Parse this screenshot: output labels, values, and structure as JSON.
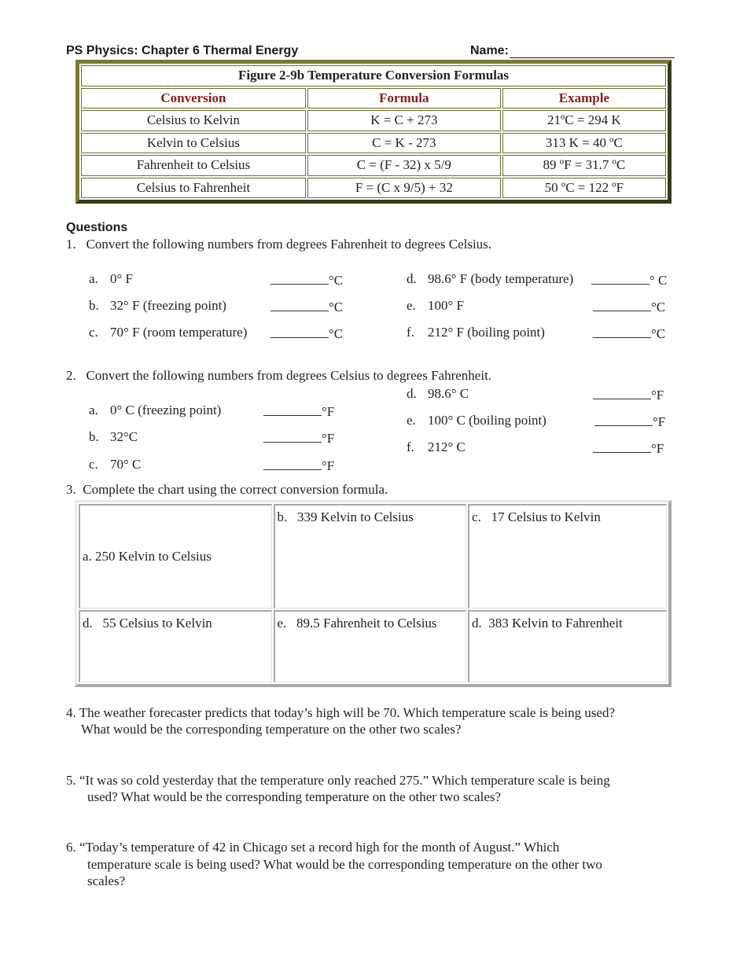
{
  "header": {
    "title": "PS Physics:  Chapter 6 Thermal Energy",
    "name_label": "Name:"
  },
  "formula_table": {
    "title": "Figure 2-9b Temperature Conversion Formulas",
    "columns": [
      "Conversion",
      "Formula",
      "Example"
    ],
    "rows": [
      {
        "conversion": "Celsius to Kelvin",
        "formula": "K = C + 273",
        "example": "21ºC = 294 K"
      },
      {
        "conversion": "Kelvin to Celsius",
        "formula": "C = K - 273",
        "example": "313 K = 40 ºC"
      },
      {
        "conversion": "Fahrenheit to Celsius",
        "formula": "C = (F - 32) x 5/9",
        "example": "89 ºF = 31.7 ºC"
      },
      {
        "conversion": "Celsius to Fahrenheit",
        "formula": "F = (C x 9/5) + 32",
        "example": "50 ºC = 122 ºF"
      }
    ],
    "colors": {
      "border_light": "#7a7a30",
      "border_dark": "#3a3a1a",
      "header_text": "#8b1a1a"
    }
  },
  "questions_heading": "Questions",
  "q1": {
    "text": "1.   Convert the following numbers from degrees Fahrenheit to degrees Celsius.",
    "items": [
      {
        "letter": "a.",
        "label": "0° F",
        "unit": "°C"
      },
      {
        "letter": "b.",
        "label": "32° F (freezing point)",
        "unit": "°C"
      },
      {
        "letter": "c.",
        "label": "70° F (room temperature)",
        "unit": "°C"
      },
      {
        "letter": "d.",
        "label": "98.6° F (body temperature)",
        "unit": "° C"
      },
      {
        "letter": "e.",
        "label": "100° F",
        "unit": "°C"
      },
      {
        "letter": "f.",
        "label": "212° F (boiling point)",
        "unit": "°C"
      }
    ]
  },
  "q2": {
    "text": "2.   Convert the following numbers from degrees Celsius to degrees Fahrenheit.",
    "items": [
      {
        "letter": "a.",
        "label": "0° C (freezing point)",
        "unit": "°F"
      },
      {
        "letter": "b.",
        "label": "32°C",
        "unit": "°F"
      },
      {
        "letter": "c.",
        "label": "70° C",
        "unit": "°F"
      },
      {
        "letter": "d.",
        "label": "98.6° C",
        "unit": "°F"
      },
      {
        "letter": "e.",
        "label": "100° C (boiling point)",
        "unit": "°F"
      },
      {
        "letter": "f.",
        "label": "212° C",
        "unit": "°F"
      }
    ]
  },
  "q3": {
    "text": "3.  Complete the chart using the correct conversion formula.",
    "cells": [
      "a. 250 Kelvin to Celsius",
      "b.   339 Kelvin to Celsius",
      "c.   17 Celsius to Kelvin",
      "d.   55 Celsius to Kelvin",
      "e.   89.5 Fahrenheit to Celsius",
      "d.  383 Kelvin to Fahrenheit"
    ]
  },
  "q4": {
    "line1": "4. The weather forecaster predicts that today’s high will be 70. Which temperature scale is being used?",
    "line2": "What would be the corresponding temperature on the other two scales?"
  },
  "q5": {
    "line1": "5. “It was so cold yesterday that the temperature only reached 275.” Which temperature scale is being",
    "line2": "used? What would be the corresponding temperature on the other two scales?"
  },
  "q6": {
    "line1": "6. “Today’s temperature of 42 in Chicago set a record high for the month of August.” Which",
    "line2": "temperature scale is being used? What would be the corresponding temperature on the other two",
    "line3": "scales?"
  }
}
